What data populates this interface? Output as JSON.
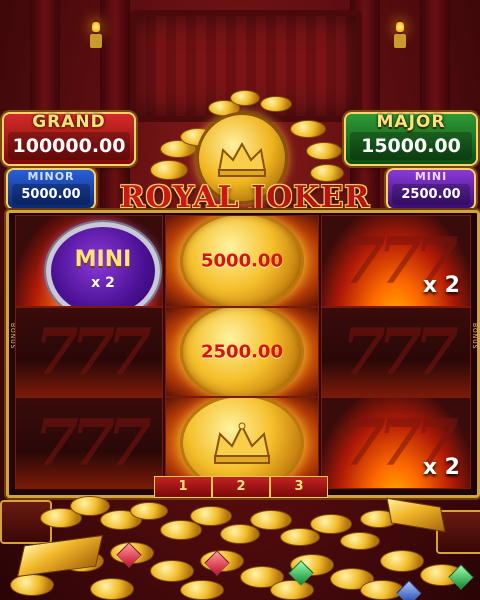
{
  "jackpots": {
    "grand": {
      "label": "GRAND",
      "value": "100000.00"
    },
    "major": {
      "label": "MAJOR",
      "value": "15000.00"
    },
    "minor": {
      "label": "MINOR",
      "value": "5000.00"
    },
    "mini": {
      "label": "MINI",
      "value": "2500.00"
    }
  },
  "logo": {
    "word1": "ROYAL",
    "word2": "JOKER"
  },
  "reels": {
    "side_label": "BONUS",
    "cells": {
      "r0c0": {
        "type": "jackpot-badge",
        "label": "MINI",
        "multiplier": "x 2"
      },
      "r0c1": {
        "type": "money-coin",
        "value": "5000.00"
      },
      "r0c2": {
        "type": "multiplier",
        "multiplier": "x 2"
      },
      "r1c0": {
        "type": "empty"
      },
      "r1c1": {
        "type": "money-coin",
        "value": "2500.00"
      },
      "r1c2": {
        "type": "empty"
      },
      "r2c0": {
        "type": "empty"
      },
      "r2c1": {
        "type": "crown-coin"
      },
      "r2c2": {
        "type": "multiplier",
        "multiplier": "x 2"
      }
    },
    "tabs": [
      "1",
      "2",
      "3"
    ]
  },
  "colors": {
    "grand": "#c42222",
    "major": "#2f9a35",
    "minor": "#2a5fd8",
    "mini": "#8a3ad8",
    "gold": "#f5c02c",
    "accent_text": "#ffe27a"
  },
  "icons": [
    "crown-icon",
    "candle-sconce-icon",
    "gold-bar-icon",
    "gem-icon",
    "treasure-chest-icon"
  ]
}
